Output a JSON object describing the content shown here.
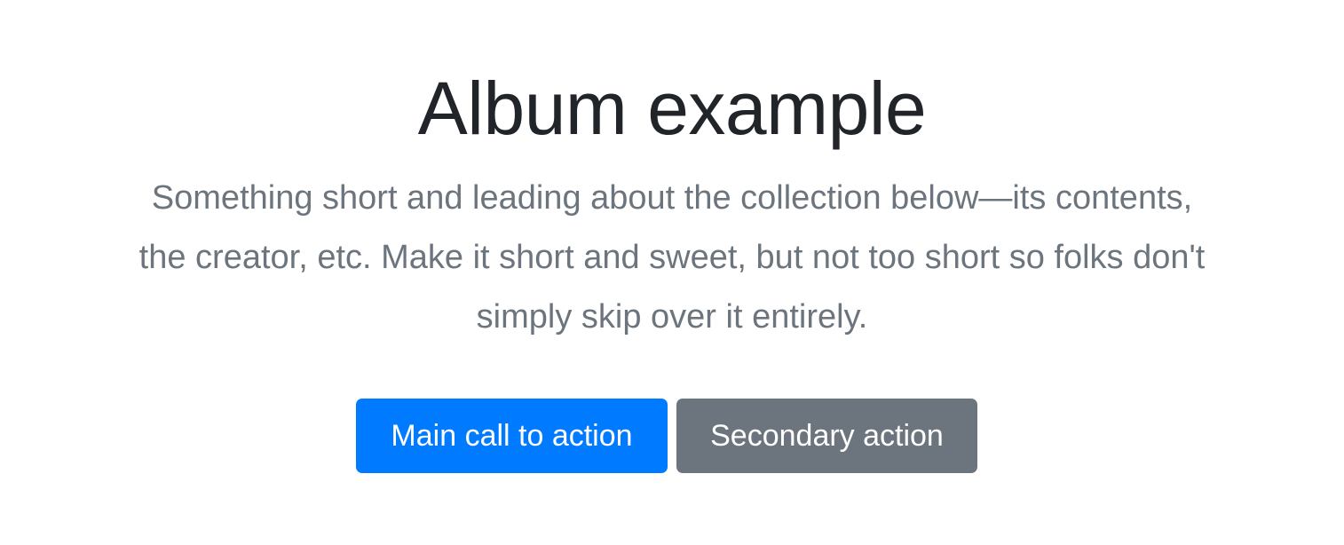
{
  "hero": {
    "title": "Album example",
    "lead_lines": [
      "Something short and leading about the collection below—its contents,",
      "the creator, etc. Make it short and sweet, but not too short so folks don't",
      "simply skip over it entirely."
    ],
    "primary_button": "Main call to action",
    "secondary_button": "Secondary action"
  },
  "colors": {
    "primary": "#007bff",
    "secondary": "#6c757d",
    "heading": "#212529",
    "lead": "#6c757d"
  }
}
